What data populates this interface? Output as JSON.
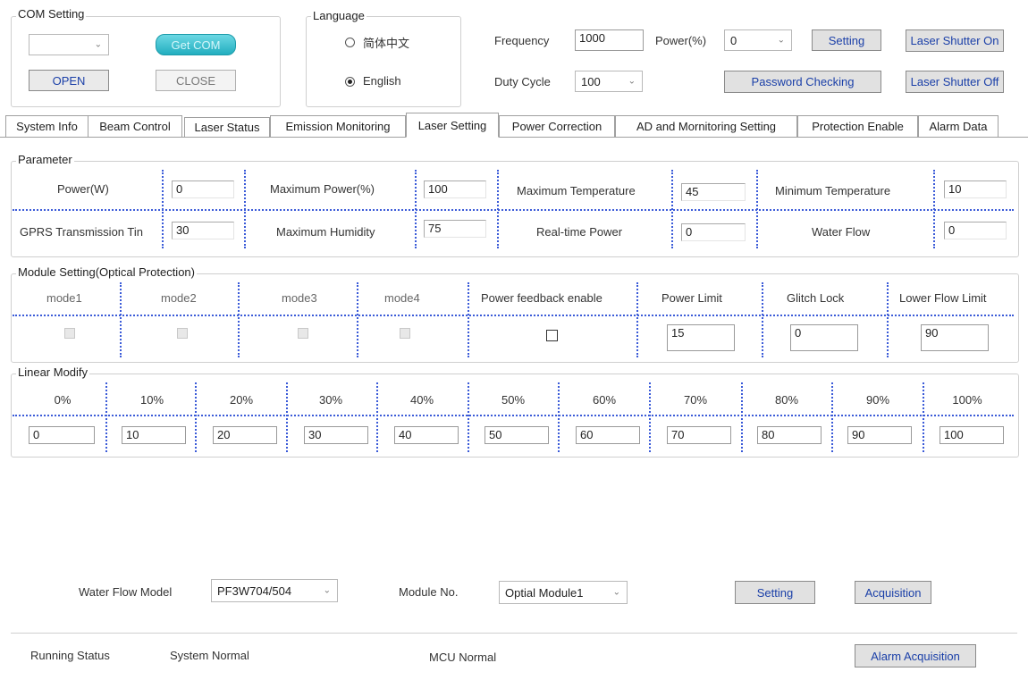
{
  "com": {
    "title": "COM Setting",
    "port_value": "",
    "get_com": "Get COM",
    "open": "OPEN",
    "close": "CLOSE"
  },
  "language": {
    "title": "Language",
    "chinese": "简体中文",
    "english": "English",
    "selected": "English"
  },
  "top": {
    "frequency_label": "Frequency",
    "frequency_value": "1000",
    "power_label": "Power(%)",
    "power_value": "0",
    "setting": "Setting",
    "shutter_on": "Laser Shutter On",
    "duty_label": "Duty Cycle",
    "duty_value": "100",
    "password_checking": "Password Checking",
    "shutter_off": "Laser Shutter Off"
  },
  "tabs": [
    "System Info",
    "Beam Control",
    "Laser Status",
    "Emission Monitoring",
    "Laser Setting",
    "Power Correction",
    "AD and Mornitoring Setting",
    "Protection Enable",
    "Alarm Data"
  ],
  "selected_tab": "Laser Setting",
  "parameter": {
    "title": "Parameter",
    "power_w_label": "Power(W)",
    "power_w": "0",
    "max_power_label": "Maximum Power(%)",
    "max_power": "100",
    "max_temp_label": "Maximum Temperature",
    "max_temp": "45",
    "min_temp_label": "Minimum Temperature",
    "min_temp": "10",
    "gprs_label": "GPRS Transmission Tin",
    "gprs": "30",
    "max_humidity_label": "Maximum Humidity",
    "max_humidity": "75",
    "realtime_power_label": "Real-time Power",
    "realtime_power": "0",
    "water_flow_label": "Water Flow",
    "water_flow": "0"
  },
  "module": {
    "title": "Module Setting(Optical Protection)",
    "mode1": "mode1",
    "mode2": "mode2",
    "mode3": "mode3",
    "mode4": "mode4",
    "feedback_label": "Power feedback enable",
    "power_limit_label": "Power Limit",
    "power_limit": "15",
    "glitch_lock_label": "Glitch Lock",
    "glitch_lock": "0",
    "lower_flow_label": "Lower Flow Limit",
    "lower_flow": "90"
  },
  "linear": {
    "title": "Linear Modify",
    "headers": [
      "0%",
      "10%",
      "20%",
      "30%",
      "40%",
      "50%",
      "60%",
      "70%",
      "80%",
      "90%",
      "100%"
    ],
    "values": [
      "0",
      "10",
      "20",
      "30",
      "40",
      "50",
      "60",
      "70",
      "80",
      "90",
      "100"
    ]
  },
  "bottom": {
    "water_flow_model_label": "Water Flow Model",
    "water_flow_model": "PF3W704/504",
    "module_no_label": "Module No.",
    "module_no": "Optial Module1",
    "setting": "Setting",
    "acquisition": "Acquisition"
  },
  "status": {
    "running_label": "Running Status",
    "system": "System Normal",
    "mcu": "MCU Normal",
    "alarm_acquisition": "Alarm Acquisition"
  }
}
